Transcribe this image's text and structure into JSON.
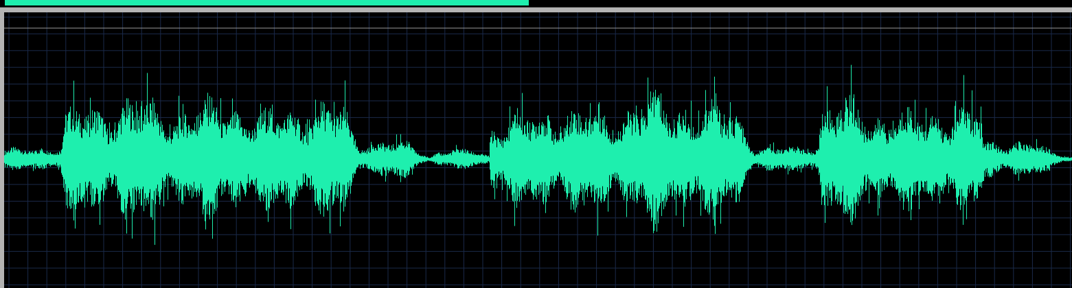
{
  "waveform_view": {
    "waveform": {
      "kind": "waveform"
    }
  }
}
